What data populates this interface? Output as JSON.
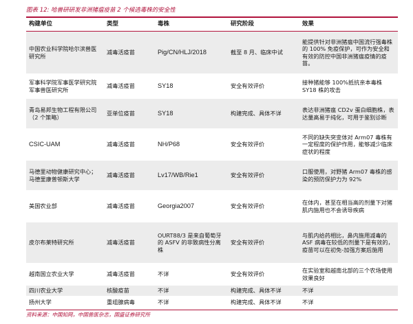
{
  "caption": "图表 12: 哈兽研研发非洲猪瘟疫苗 2 个候选毒株的安全性",
  "columns": [
    "构建单位",
    "类型",
    "毒株",
    "研究阶段",
    "效果"
  ],
  "rows": [
    [
      "中国农业科学院哈尔滨兽医研究所",
      "减毒活疫苗",
      "Pig/CN/HLJ/2018",
      "截至 8 月、临床中试",
      "能提供针对非洲猪瘟中国流行强毒株的 100% 免疫保护，可作为安全和有效的防控中国非洲猪瘟疫情的疫苗。"
    ],
    [
      "军事科学院军事医学研究院军事兽医研究所",
      "减毒活疫苗",
      "SY18",
      "安全有效评价",
      "接种猪能够 100%抵抗亲本毒株 SY18 株的攻击"
    ],
    [
      "青岛易邦生物工程有限公司（2 个策略）",
      "亚单位疫苗",
      "SY18",
      "构建完成、具体不详",
      "表达非洲猪瘟 CD2v 蛋白细胞株，表达量高易于纯化，可用于鉴别诊断"
    ],
    [
      "CSIC-UAM",
      "减毒活疫苗",
      "NH/P68",
      "安全有效评价",
      "不同的缺失突变体对 Arm07 毒株有一定程度的保护作用，能够减少临床症状的程度"
    ],
    [
      "马德里动物健康研究中心；马德里康普顿斯大学",
      "减毒活疫苗",
      "Lv17/WB/Rie1",
      "安全有效评价",
      "口服使用，对野猪 Arm07 毒株的感染的预防保护力为 92%"
    ],
    [
      "美国农业部",
      "减毒活疫苗",
      "Georgia2007",
      "安全有效评价",
      "在体内，甚至在相当高的剂量下对猪肌内施用也不会诱导疾病"
    ],
    [
      "皮尔布莱特研究所",
      "减毒活疫苗",
      "OURT88/3 是来自葡萄牙的 ASFV 的非致病性分离株",
      "安全有效评价",
      "与肌内给药相比，鼻内施用减毒的 ASF 病毒在较低的剂量下是有效的，疫苗可以在初免-加强方案后施用"
    ],
    [
      "越南国立农业大学",
      "减毒活疫苗",
      "不详",
      "安全有效评价",
      "在实验室和越南北部的三个农场使用效果良好"
    ],
    [
      "四川农业大学",
      "核酸疫苗",
      "不详",
      "构建完成、具体不详",
      "不详"
    ],
    [
      "扬州大学",
      "重组腺病毒",
      "不详",
      "构建完成、具体不详",
      "不详"
    ]
  ],
  "source": "资料来源：中国知网，中国兽医杂志，国盛证券研究所"
}
